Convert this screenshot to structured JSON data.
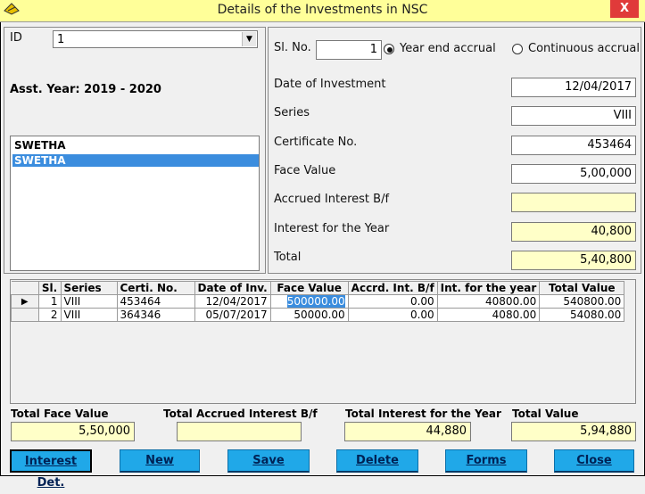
{
  "window": {
    "title": "Details of the Investments in NSC",
    "close_glyph": "X"
  },
  "left": {
    "id_label": "ID",
    "id_value": "1",
    "asst_year": "Asst. Year: 2019 - 2020",
    "names": [
      "SWETHA",
      "SWETHA"
    ]
  },
  "form": {
    "slno_label": "Sl. No.",
    "slno_value": "1",
    "radio_year_end": "Year end accrual",
    "radio_continuous": "Continuous accrual",
    "date_label": "Date of Investment",
    "date_value": "12/04/2017",
    "series_label": "Series",
    "series_value": "VIII",
    "cert_label": "Certificate No.",
    "cert_value": "453464",
    "face_label": "Face Value",
    "face_value": "5,00,000",
    "accrued_label": "Accrued Interest B/f",
    "accrued_value": "",
    "interest_label": "Interest for the Year",
    "interest_value": "40,800",
    "total_label": "Total",
    "total_value": "5,40,800"
  },
  "grid": {
    "columns": [
      "Sl.",
      "Series",
      "Certi. No.",
      "Date of Inv.",
      "Face Value",
      "Accrd. Int. B/f",
      "Int. for the year",
      "Total Value"
    ],
    "rows": [
      [
        "1",
        "VIII",
        "453464",
        "12/04/2017",
        "500000.00",
        "0.00",
        "40800.00",
        "540800.00"
      ],
      [
        "2",
        "VIII",
        "364346",
        "05/07/2017",
        "50000.00",
        "0.00",
        "4080.00",
        "54080.00"
      ]
    ]
  },
  "totals": {
    "face_label": "Total Face Value",
    "face_value": "5,50,000",
    "accrued_label": "Total Accrued Interest B/f",
    "accrued_value": "",
    "interest_label": "Total Interest for the Year",
    "interest_value": "44,880",
    "value_label": "Total Value",
    "value_value": "5,94,880"
  },
  "buttons": {
    "interest_det": "Interest Det.",
    "new": "New",
    "save": "Save",
    "delete": "Delete",
    "forms": "Forms",
    "close": "Close"
  },
  "colors": {
    "title_bg": "#ffff99",
    "accent": "#3b8dde",
    "button": "#20a8e8",
    "highlight_field": "#ffffc8"
  }
}
